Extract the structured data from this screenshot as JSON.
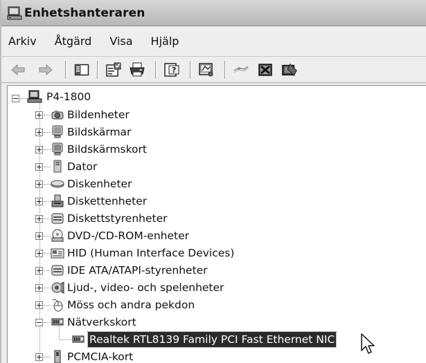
{
  "window": {
    "title": "Enhetshanteraren",
    "title_icon": "computer-manager-icon"
  },
  "menu": {
    "items": [
      "Arkiv",
      "Åtgärd",
      "Visa",
      "Hjälp"
    ]
  },
  "toolbar": {
    "buttons": [
      {
        "name": "back-arrow-icon"
      },
      {
        "name": "forward-arrow-icon"
      },
      {
        "name": "show-hide-console-tree-icon"
      },
      {
        "name": "properties-icon"
      },
      {
        "name": "print-icon"
      },
      {
        "name": "help-icon"
      },
      {
        "name": "scan-hardware-icon"
      },
      {
        "name": "update-driver-icon"
      },
      {
        "name": "disable-device-icon"
      },
      {
        "name": "uninstall-device-icon"
      }
    ]
  },
  "tree": {
    "root": {
      "label": "P4-1800",
      "icon": "computer-icon",
      "expanded": true
    },
    "categories": [
      {
        "label": "Bildenheter",
        "icon": "camera-icon",
        "expanded": false
      },
      {
        "label": "Bildskärmar",
        "icon": "monitor-icon",
        "expanded": false
      },
      {
        "label": "Bildskärmskort",
        "icon": "display-adapter-icon",
        "expanded": false
      },
      {
        "label": "Dator",
        "icon": "computer-case-icon",
        "expanded": false
      },
      {
        "label": "Diskenheter",
        "icon": "disk-drive-icon",
        "expanded": false
      },
      {
        "label": "Diskettenheter",
        "icon": "floppy-drive-icon",
        "expanded": false
      },
      {
        "label": "Diskettstyrenheter",
        "icon": "floppy-controller-icon",
        "expanded": false
      },
      {
        "label": "DVD-/CD-ROM-enheter",
        "icon": "cd-rom-icon",
        "expanded": false
      },
      {
        "label": "HID (Human Interface Devices)",
        "icon": "hid-icon",
        "expanded": false
      },
      {
        "label": "IDE ATA/ATAPI-styrenheter",
        "icon": "ide-controller-icon",
        "expanded": false
      },
      {
        "label": "Ljud-, video- och spelenheter",
        "icon": "sound-icon",
        "expanded": false
      },
      {
        "label": "Möss och andra pekdon",
        "icon": "mouse-icon",
        "expanded": false
      },
      {
        "label": "Nätverkskort",
        "icon": "network-adapter-icon",
        "expanded": true,
        "children": [
          {
            "label": "Realtek RTL8139 Family PCI Fast Ethernet NIC",
            "icon": "network-card-icon",
            "selected": true
          }
        ]
      },
      {
        "label": "PCMCIA-kort",
        "icon": "pcmcia-icon",
        "expanded": false
      }
    ]
  },
  "colors": {
    "selection_bg": "#2b2b2b",
    "selection_text": "#ffffff",
    "titlebar": "#c8c8c8",
    "tree_bg": "#ffffff"
  }
}
